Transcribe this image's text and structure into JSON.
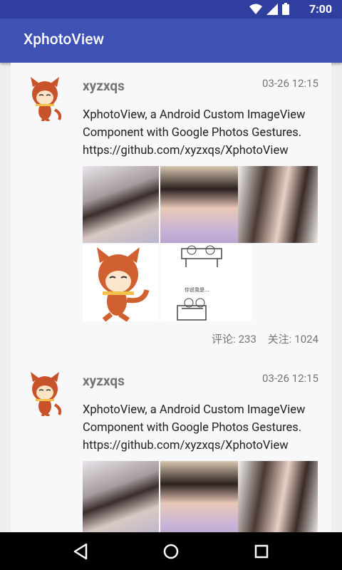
{
  "status_bar": {
    "time": "7:00",
    "icons": [
      "wifi-icon",
      "signal-icon",
      "battery-icon"
    ]
  },
  "app_bar": {
    "title": "XphotoView"
  },
  "posts": [
    {
      "username": "xyzxqs",
      "timestamp": "03-26 12:15",
      "text": "XphotoView, a Android Custom ImageView Component with Google Photos Gestures. https://github.com/xyzxqs/XphotoView",
      "stats": {
        "comments_label": "评论:",
        "comments_count": "233",
        "follows_label": "关注:",
        "follows_count": "1024"
      }
    },
    {
      "username": "xyzxqs",
      "timestamp": "03-26 12:15",
      "text": "XphotoView, a Android Custom ImageView Component with Google Photos Gestures. https://github.com/xyzxqs/XphotoView"
    }
  ],
  "colors": {
    "primary": "#3f51b5",
    "primary_dark": "#303f9f",
    "text_primary": "#212121",
    "text_secondary": "#757575"
  },
  "nav_bar": {
    "icons": [
      "back-icon",
      "home-icon",
      "recents-icon"
    ]
  }
}
